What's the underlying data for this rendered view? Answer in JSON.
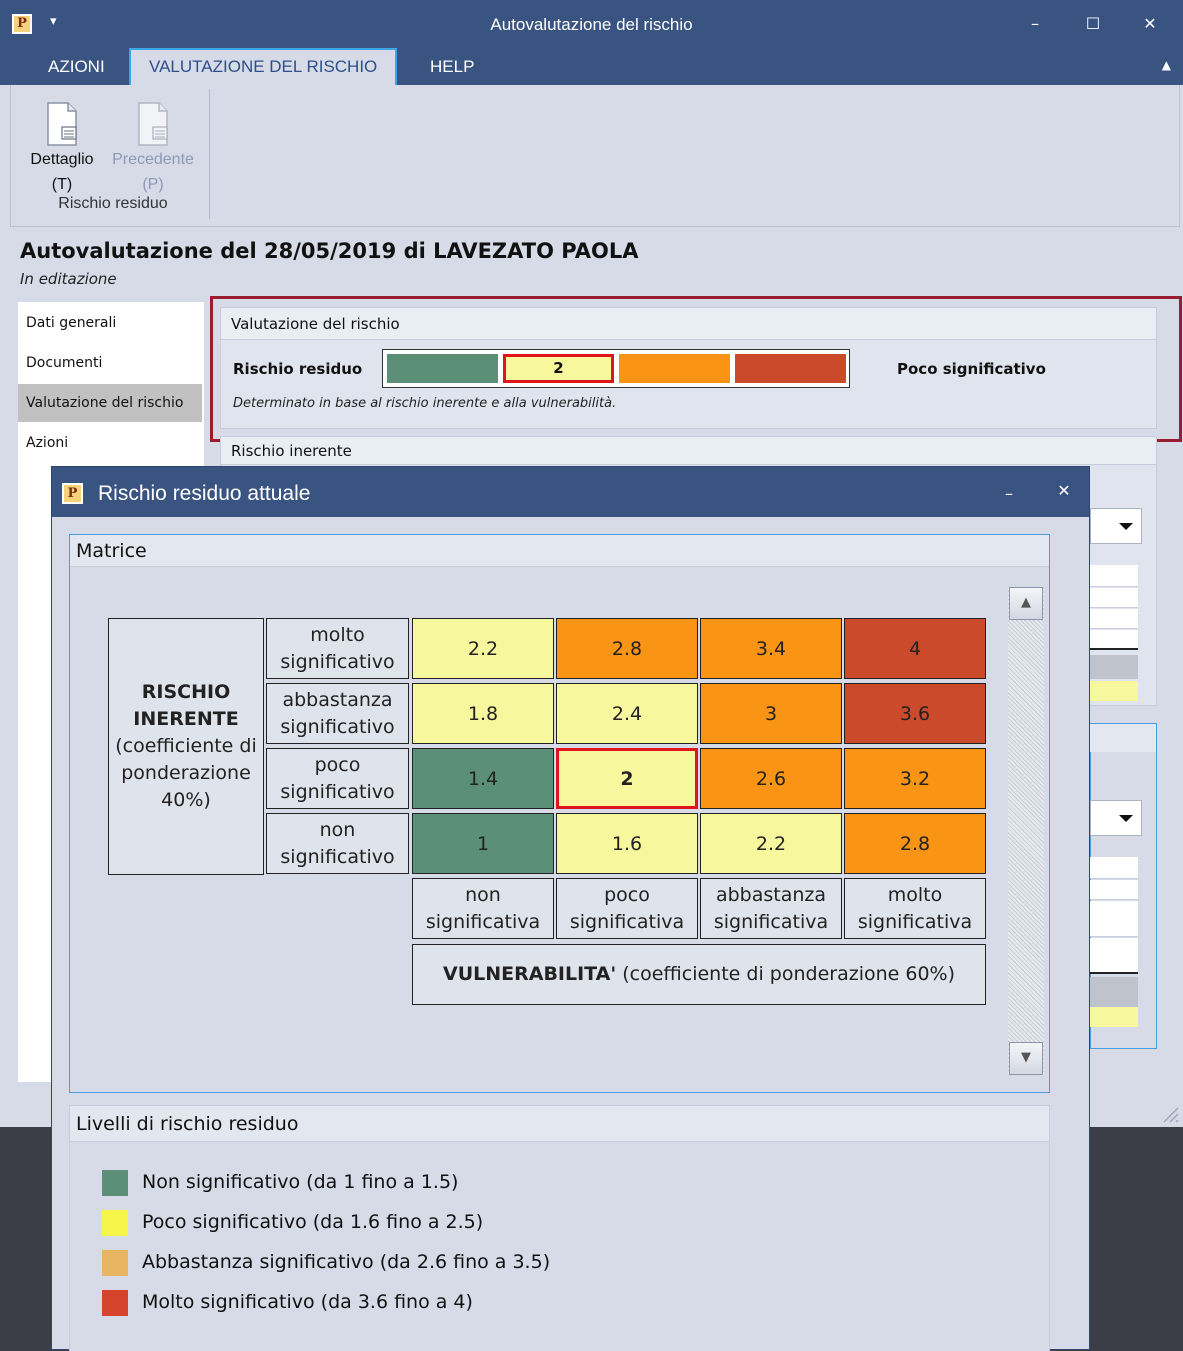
{
  "window": {
    "title": "Autovalutazione del rischio",
    "app_icon": "P",
    "quick_access": "▾",
    "minimize": "–",
    "maximize": "☐",
    "close": "✕"
  },
  "ribbon": {
    "tabs": [
      {
        "label": "AZIONI"
      },
      {
        "label": "VALUTAZIONE DEL RISCHIO",
        "active": true
      },
      {
        "label": "HELP"
      }
    ],
    "collapse": "▲",
    "buttons": [
      {
        "label": "Dettaglio",
        "shortcut": "(T)",
        "icon": "document-icon",
        "enabled": true
      },
      {
        "label": "Precedente",
        "shortcut": "(P)",
        "icon": "document-icon",
        "enabled": false
      }
    ],
    "group_label": "Rischio residuo"
  },
  "page": {
    "title": "Autovalutazione del 28/05/2019 di LAVEZATO PAOLA",
    "status": "In editazione"
  },
  "sidebar": {
    "items": [
      {
        "label": "Dati generali"
      },
      {
        "label": "Documenti"
      },
      {
        "label": "Valutazione del rischio",
        "active": true
      },
      {
        "label": "Azioni"
      }
    ]
  },
  "valutazione": {
    "header": "Valutazione del rischio",
    "label": "Rischio residuo",
    "value": "2",
    "level": "Poco significativo",
    "note": "Determinato in base al rischio inerente e alla vulnerabilità.",
    "next_header": "Rischio inerente"
  },
  "colors": {
    "green": "#5b8f78",
    "yellow": "#f7f79d",
    "orange": "#fa9414",
    "red": "#cb4a2b",
    "selected_border": "#e0141c",
    "legend_green": "#5b8f78",
    "legend_yellow": "#f5f54a",
    "legend_orange": "#e8b562",
    "legend_red": "#d4432c"
  },
  "dialog": {
    "title": "Rischio residuo attuale",
    "app_icon": "P",
    "minimize": "–",
    "close": "✕",
    "matrix_header": "Matrice",
    "row_axis_bold": "RISCHIO INERENTE",
    "row_axis_rest": "(coefficiente di ponderazione 40%)",
    "rows": [
      {
        "label": "molto significativo",
        "values": [
          "2.2",
          "2.8",
          "3.4",
          "4"
        ],
        "colors": [
          "yellow",
          "orange",
          "orange",
          "red"
        ]
      },
      {
        "label": "abbastanza significativo",
        "values": [
          "1.8",
          "2.4",
          "3",
          "3.6"
        ],
        "colors": [
          "yellow",
          "yellow",
          "orange",
          "red"
        ]
      },
      {
        "label": "poco significativo",
        "values": [
          "1.4",
          "2",
          "2.6",
          "3.2"
        ],
        "colors": [
          "green",
          "yellow",
          "orange",
          "orange"
        ]
      },
      {
        "label": "non significativo",
        "values": [
          "1",
          "1.6",
          "2.2",
          "2.8"
        ],
        "colors": [
          "green",
          "yellow",
          "yellow",
          "orange"
        ]
      }
    ],
    "selected": {
      "row": 2,
      "col": 1
    },
    "columns": [
      "non significativa",
      "poco significativa",
      "abbastanza significativa",
      "molto significativa"
    ],
    "col_axis_bold": "VULNERABILITA'",
    "col_axis_rest": " (coefficiente di ponderazione 60%)",
    "scroll_up": "▲",
    "scroll_down": "▼",
    "levels_header": "Livelli di rischio residuo",
    "levels": [
      {
        "label": "Non significativo (da 1 fino a 1.5)",
        "color": "legend_green"
      },
      {
        "label": "Poco significativo (da 1.6 fino a 2.5)",
        "color": "legend_yellow"
      },
      {
        "label": "Abbastanza significativo (da 2.6 fino a 3.5)",
        "color": "legend_orange"
      },
      {
        "label": "Molto significativo (da 3.6 fino a 4)",
        "color": "legend_red"
      }
    ]
  }
}
